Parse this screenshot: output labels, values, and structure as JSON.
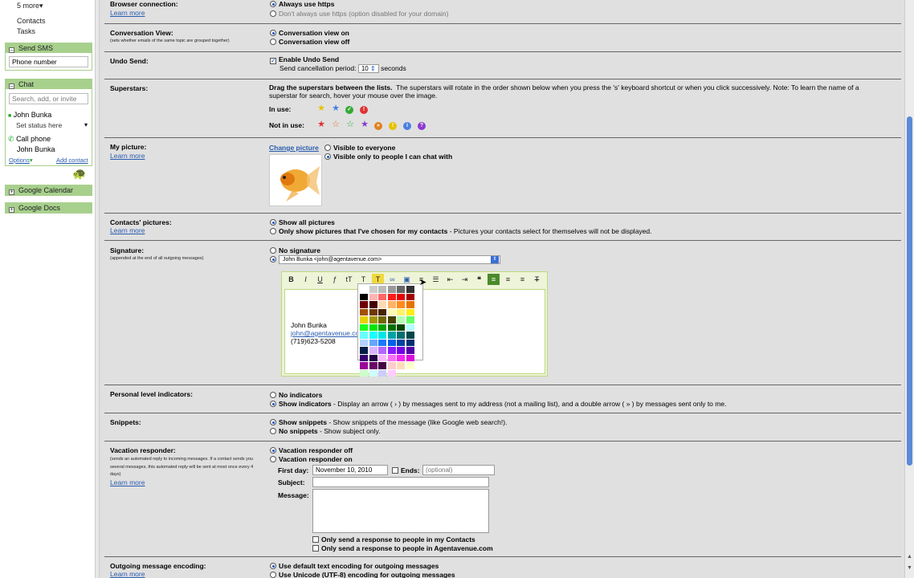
{
  "sidebar": {
    "more": "5 more",
    "contacts": "Contacts",
    "tasks": "Tasks",
    "sms_title": "Send SMS",
    "sms_placeholder": "Phone number",
    "chat_title": "Chat",
    "chat_search": "Search, add, or invite",
    "user_name": "John Bunka",
    "status": "Set status here",
    "call_phone": "Call phone",
    "call_name": "John Bunka",
    "options": "Options",
    "add_contact": "Add contact",
    "calendar": "Google Calendar",
    "docs": "Google Docs"
  },
  "settings": {
    "browser": {
      "label": "Browser connection:",
      "learn": "Learn more",
      "opt1": "Always use https",
      "opt2": "Don't always use https (option disabled for your domain)"
    },
    "conversation": {
      "label": "Conversation View:",
      "sub": "(sets whether emails of the same topic are grouped together)",
      "opt1": "Conversation view on",
      "opt2": "Conversation view off"
    },
    "undo": {
      "label": "Undo Send:",
      "enable": "Enable Undo Send",
      "period": "Send cancellation period:",
      "value": "10",
      "unit": "seconds"
    },
    "superstars": {
      "label": "Superstars:",
      "bold": "Drag the superstars between the lists.",
      "desc": "The superstars will rotate in the order shown below when you press the 's' keyboard shortcut or when you click successively. Note: To learn the name of a superstar for search, hover your mouse over the image.",
      "in_use": "In use:",
      "not_in_use": "Not in use:"
    },
    "picture": {
      "label": "My picture:",
      "learn": "Learn more",
      "change": "Change picture",
      "opt1": "Visible to everyone",
      "opt2": "Visible only to people I can chat with"
    },
    "contacts_pic": {
      "label": "Contacts' pictures:",
      "learn": "Learn more",
      "opt1": "Show all pictures",
      "opt2": "Only show pictures that I've chosen for my contacts",
      "opt2_desc": " - Pictures your contacts select for themselves will not be displayed."
    },
    "signature": {
      "label": "Signature:",
      "sub": "(appended at the end of all outgoing messages)",
      "opt1": "No signature",
      "select": "John Bunka <john@agentavenue.com>",
      "line1": "John Bunka",
      "line2": "john@agentavenue.co",
      "line3": "(719)623-5208"
    },
    "personal": {
      "label": "Personal level indicators:",
      "opt1": "No indicators",
      "opt2": "Show indicators",
      "opt2_desc": " - Display an arrow ( › ) by messages sent to my address (not a mailing list), and a double arrow ( » ) by messages sent only to me."
    },
    "snippets": {
      "label": "Snippets:",
      "opt1": "Show snippets",
      "opt1_desc": " - Show snippets of the message (like Google web search!).",
      "opt2": "No snippets",
      "opt2_desc": " - Show subject only."
    },
    "vacation": {
      "label": "Vacation responder:",
      "sub": "(sends an automated reply to incoming messages. If a contact sends you several messages, this automated reply will be sent at most once every 4 days)",
      "learn": "Learn more",
      "opt1": "Vacation responder off",
      "opt2": "Vacation responder on",
      "first_day": "First day:",
      "first_day_value": "November 10, 2010",
      "ends": "Ends:",
      "ends_placeholder": "(optional)",
      "subject": "Subject:",
      "message": "Message:",
      "only_contacts": "Only send a response to people in my Contacts",
      "only_domain": "Only send a response to people in Agentavenue.com"
    },
    "encoding": {
      "label": "Outgoing message encoding:",
      "learn": "Learn more",
      "opt1": "Use default text encoding for outgoing messages",
      "opt2": "Use Unicode (UTF-8) encoding for outgoing messages"
    }
  },
  "colors": {
    "accent": "#a8d08d",
    "link": "#2a5db0",
    "main_bg": "#e0e0e0"
  }
}
